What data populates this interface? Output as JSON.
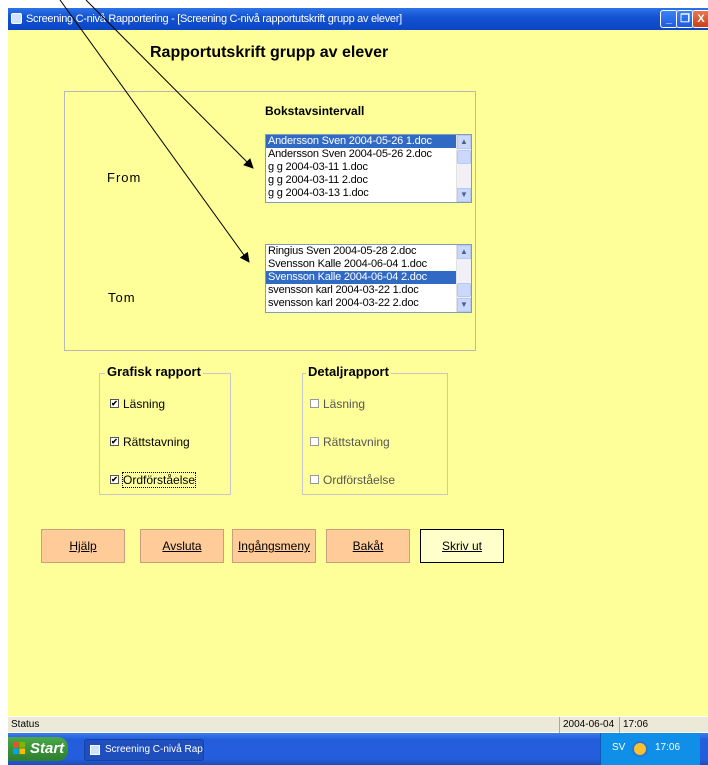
{
  "window": {
    "title": "Screening C-nivå Rapportering - [Screening C-nivå rapportutskrift grupp av elever]",
    "minimize_glyph": "_",
    "restore_glyph": "❐",
    "close_glyph": "X"
  },
  "page_title": "Rapportutskrift grupp av elever",
  "interval": {
    "heading": "Bokstavsintervall",
    "from_label": "From",
    "tom_label": "Tom",
    "from_list": [
      "Andersson Sven 2004-05-26 1.doc",
      "Andersson Sven 2004-05-26 2.doc",
      "g g 2004-03-11 1.doc",
      "g g 2004-03-11 2.doc",
      "g g 2004-03-13 1.doc"
    ],
    "from_selected_index": 0,
    "tom_list": [
      "Ringius Sven 2004-05-28 2.doc",
      "Svensson  Kalle  2004-06-04 1.doc",
      "Svensson  Kalle  2004-06-04 2.doc",
      "svensson karl 2004-03-22 1.doc",
      "svensson karl 2004-03-22 2.doc"
    ],
    "tom_selected_index": 2
  },
  "grafisk": {
    "legend": "Grafisk rapport",
    "items": [
      {
        "label": "Läsning",
        "checked": true
      },
      {
        "label": "Rättstavning",
        "checked": true
      },
      {
        "label": "Ordförståelse",
        "checked": true
      }
    ]
  },
  "detalj": {
    "legend": "Detaljrapport",
    "items": [
      {
        "label": "Läsning",
        "checked": false
      },
      {
        "label": "Rättstavning",
        "checked": false
      },
      {
        "label": "Ordförståelse",
        "checked": false
      }
    ]
  },
  "buttons": {
    "hjalp": "Hjälp",
    "avsluta": "Avsluta",
    "ingangsmeny": "Ingångsmeny",
    "bakat": "Bakåt",
    "skriv_ut": "Skriv ut"
  },
  "statusbar": {
    "status": "Status",
    "date": "2004-06-04",
    "time": "17:06"
  },
  "taskbar": {
    "start": "Start",
    "task": "Screening C-nivå Rap...",
    "language": "SV",
    "clock": "17:06"
  },
  "colors": {
    "background": "#ffff99",
    "button": "#ffcc99",
    "selection": "#316ac5",
    "titlebar": "#0a46c6"
  }
}
